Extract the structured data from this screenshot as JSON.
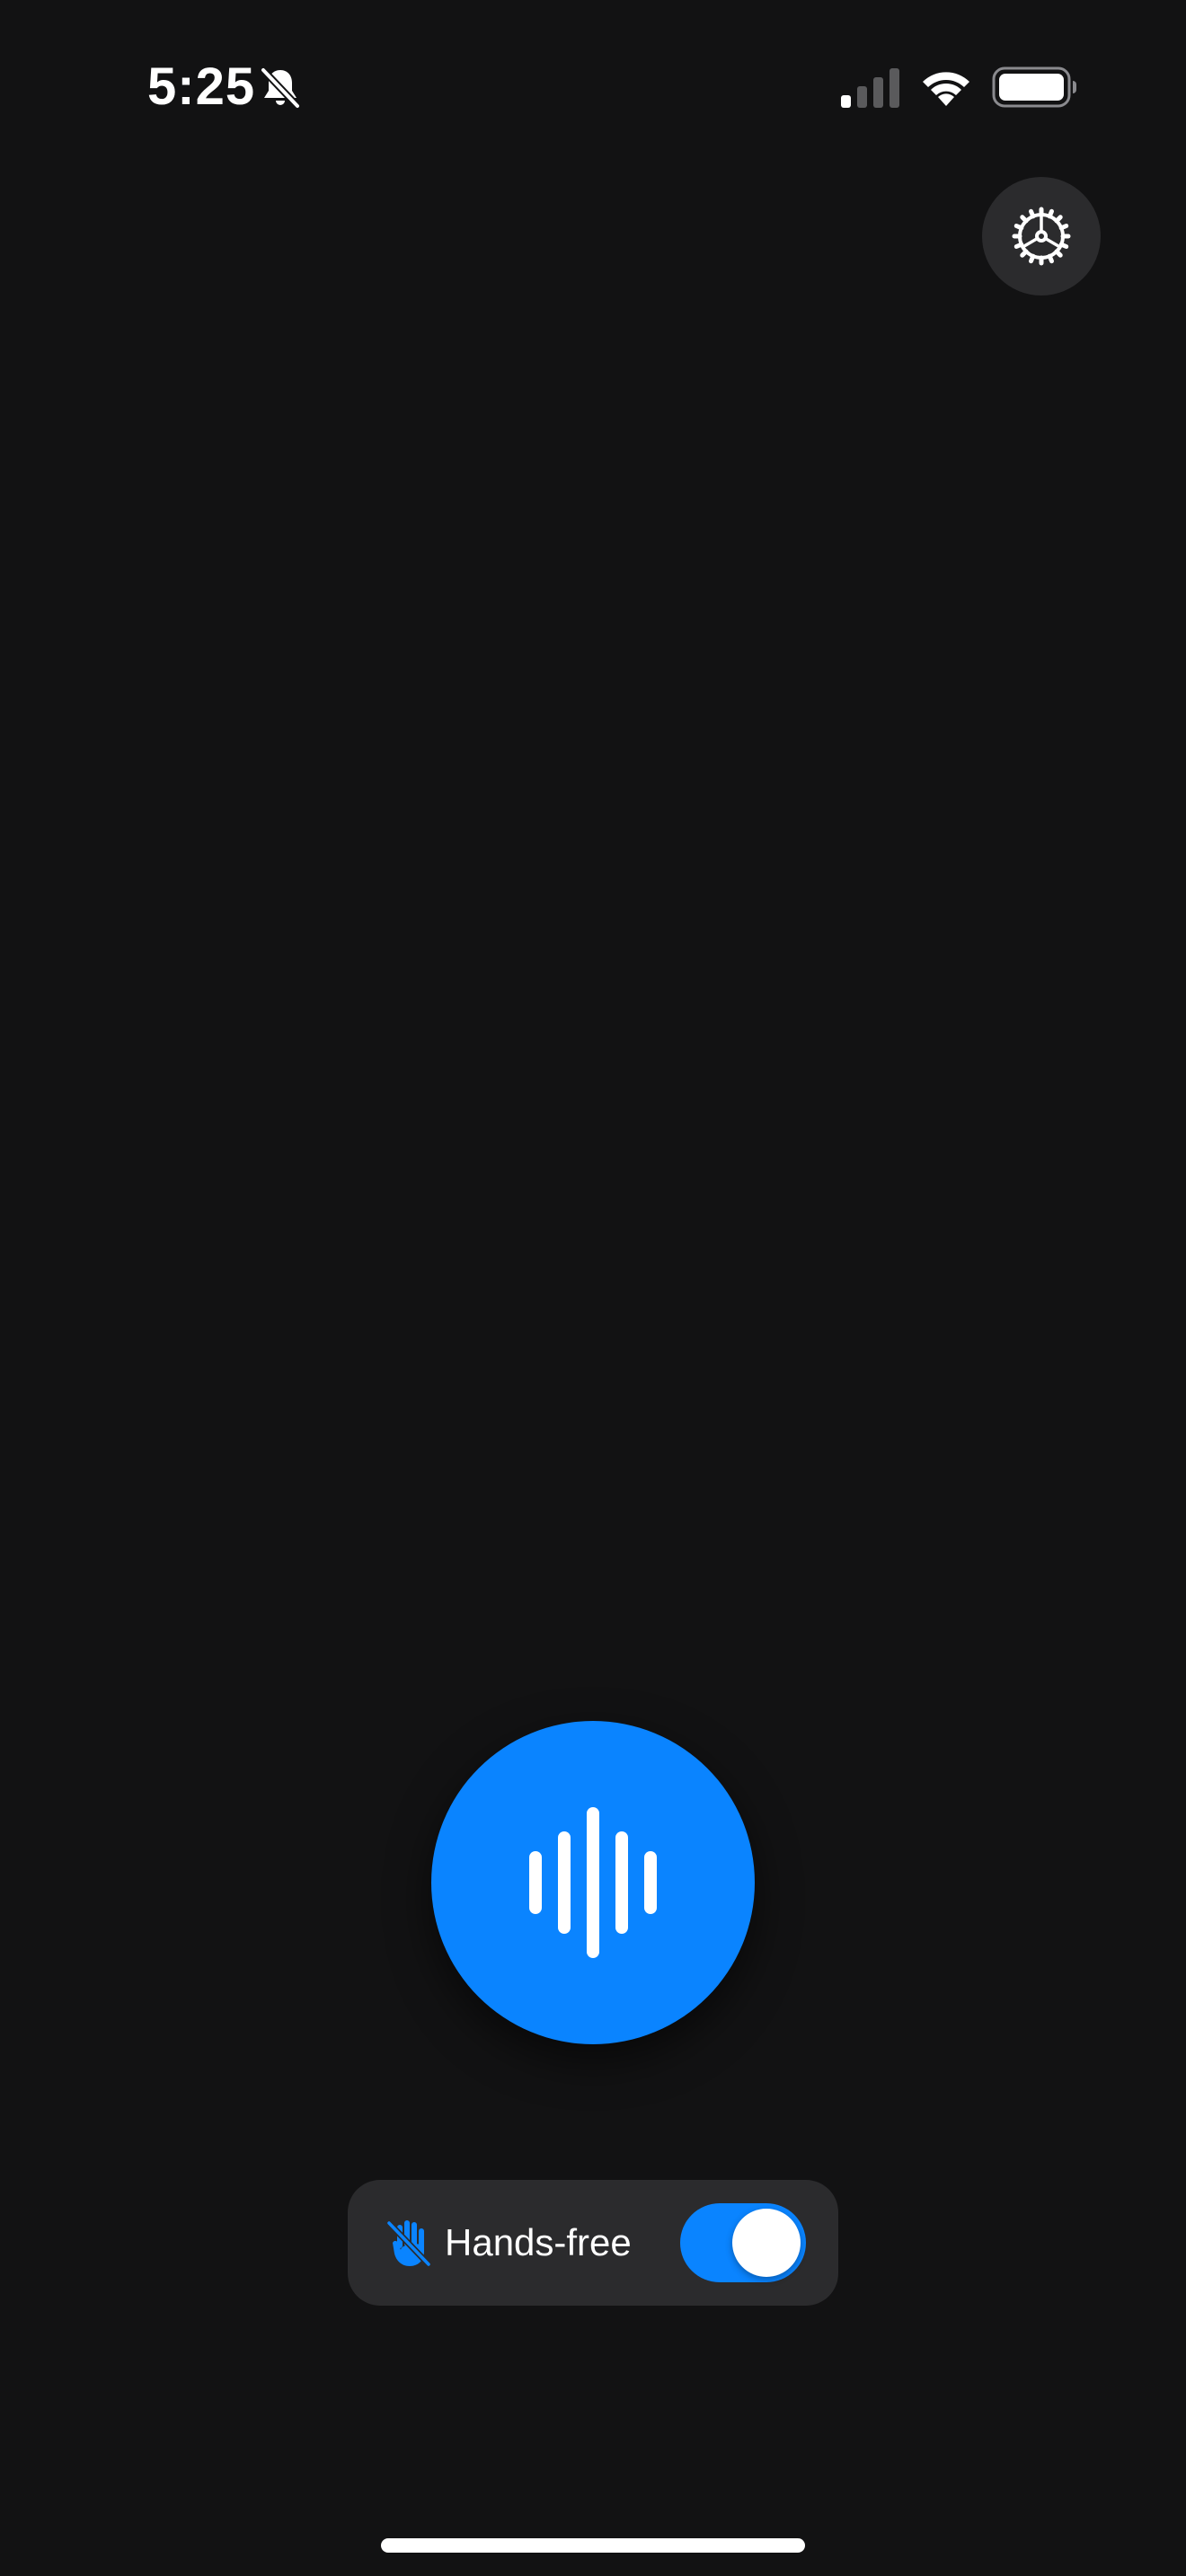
{
  "status_bar": {
    "time": "5:25",
    "icons": [
      "bell-slash-icon",
      "cellular-signal-icon",
      "wifi-icon",
      "battery-icon"
    ]
  },
  "settings": {
    "icon": "gear-icon"
  },
  "voice_button": {
    "icon": "waveform-icon",
    "color": "#0a84ff"
  },
  "hands_free": {
    "icon": "hand-raised-slash-icon",
    "label": "Hands-free",
    "enabled": true,
    "accent": "#0a84ff"
  },
  "colors": {
    "background": "#121213",
    "surface": "#2b2b2d",
    "accent": "#0a84ff"
  }
}
